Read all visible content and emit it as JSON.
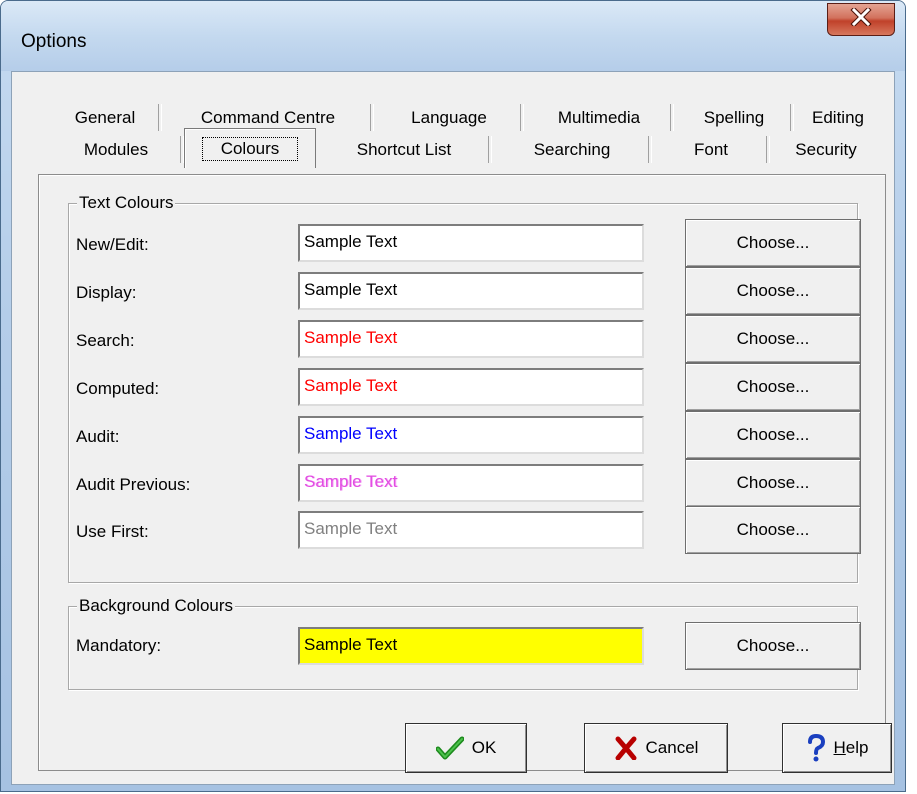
{
  "window": {
    "title": "Options",
    "close_icon": "close-icon"
  },
  "tabs": {
    "row1": [
      "General",
      "Command Centre",
      "Language",
      "Multimedia",
      "Spelling",
      "Editing"
    ],
    "row2": [
      "Modules",
      "Colours",
      "Shortcut List",
      "Searching",
      "Font",
      "Security"
    ],
    "active": "Colours"
  },
  "text_colours": {
    "group_label": "Text Colours",
    "rows": [
      {
        "label": "New/Edit:",
        "sample": "Sample Text",
        "color": "#000000",
        "button": "Choose..."
      },
      {
        "label": "Display:",
        "sample": "Sample Text",
        "color": "#000000",
        "button": "Choose..."
      },
      {
        "label": "Search:",
        "sample": "Sample Text",
        "color": "#ff0000",
        "button": "Choose..."
      },
      {
        "label": "Computed:",
        "sample": "Sample Text",
        "color": "#ff0000",
        "button": "Choose..."
      },
      {
        "label": "Audit:",
        "sample": "Sample Text",
        "color": "#0000ff",
        "button": "Choose..."
      },
      {
        "label": "Audit Previous:",
        "sample": "Sample Text",
        "color": "#ee44ee",
        "button": "Choose..."
      },
      {
        "label": "Use First:",
        "sample": "Sample Text",
        "color": "#808080",
        "button": "Choose..."
      }
    ]
  },
  "background_colours": {
    "group_label": "Background Colours",
    "rows": [
      {
        "label": "Mandatory:",
        "sample": "Sample Text",
        "color": "#000000",
        "background": "#ffff00",
        "button": "Choose..."
      }
    ]
  },
  "buttons": {
    "ok": {
      "label": "OK",
      "icon": "checkmark-icon"
    },
    "cancel": {
      "label": "Cancel",
      "icon": "x-icon"
    },
    "help": {
      "label_underlined": "H",
      "label_rest": "elp",
      "icon": "question-mark-icon"
    }
  }
}
